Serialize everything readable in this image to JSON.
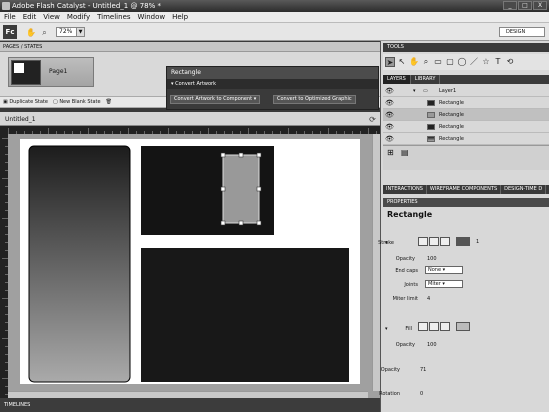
{
  "window": {
    "title": "Adobe Flash Catalyst - Untitled_1 @ 78% *",
    "controls": [
      "_",
      "□",
      "X"
    ]
  },
  "menu": [
    "File",
    "Edit",
    "View",
    "Modify",
    "Timelines",
    "Window",
    "Help"
  ],
  "toolbar": {
    "logo": "Fc",
    "zoom": "72%",
    "workspace": "DESIGN"
  },
  "pages_states": {
    "header": "PAGES / STATES",
    "page_label": "Page1",
    "duplicate": "Duplicate State",
    "new_blank": "New Blank State"
  },
  "hud": {
    "title": "Rectangle",
    "section": "Convert Artwork",
    "btn_component": "Convert Artwork to Component",
    "btn_graphic": "Convert to Optimized Graphic"
  },
  "document": {
    "tab": "Untitled_1"
  },
  "timelines": "TIMELINES",
  "tools": {
    "header": "TOOLS",
    "icons": [
      "selection-arrow",
      "direct-select",
      "hand",
      "zoom",
      "rectangle",
      "rounded-rectangle",
      "ellipse",
      "line",
      "star",
      "text",
      "3d-rotate"
    ]
  },
  "layers": {
    "tabs": [
      "LAYERS",
      "LIBRARY"
    ],
    "rows": [
      {
        "name": "Layer1",
        "type": "layer"
      },
      {
        "name": "Rectangle",
        "type": "item"
      },
      {
        "name": "Rectangle",
        "type": "item"
      },
      {
        "name": "Rectangle",
        "type": "item"
      },
      {
        "name": "Rectangle",
        "type": "item"
      }
    ]
  },
  "props_tabs": [
    "INTERACTIONS",
    "WIREFRAME COMPONENTS",
    "DESIGN-TIME D"
  ],
  "properties": {
    "header": "PROPERTIES",
    "title": "Rectangle",
    "stroke_label": "Stroke",
    "stroke_weight": "1",
    "opacity_label": "Opacity",
    "stroke_opacity": "100",
    "endcaps_label": "End caps",
    "endcaps": "None",
    "joints_label": "Joints",
    "joints": "Miter",
    "miter_label": "Miter limit",
    "miter": "4",
    "fill_label": "Fill",
    "fill_opacity": "100",
    "opacity": "71",
    "rotation_label": "Rotation",
    "rotation": "0"
  }
}
